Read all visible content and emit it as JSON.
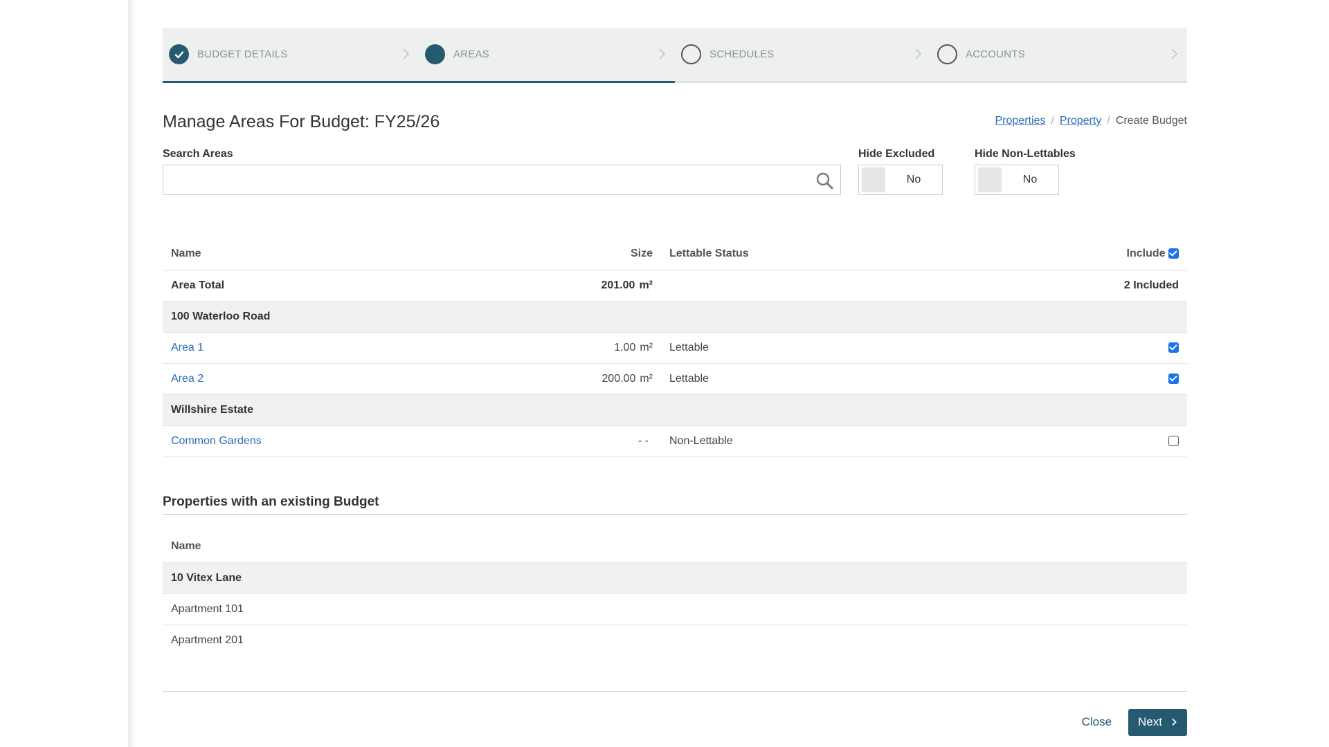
{
  "wizard": {
    "steps": [
      {
        "label": "BUDGET DETAILS",
        "state": "done"
      },
      {
        "label": "AREAS",
        "state": "current"
      },
      {
        "label": "SCHEDULES",
        "state": "todo"
      },
      {
        "label": "ACCOUNTS",
        "state": "todo"
      }
    ],
    "progress_fraction": 0.5,
    "accent_color": "#255a70"
  },
  "header": {
    "title": "Manage Areas For Budget: FY25/26",
    "breadcrumb": [
      {
        "label": "Properties",
        "link": true
      },
      {
        "label": "Property",
        "link": true
      },
      {
        "label": "Create Budget",
        "link": false
      }
    ],
    "separator": "/"
  },
  "filters": {
    "search_label": "Search Areas",
    "search_value": "",
    "hide_excluded_label": "Hide Excluded",
    "hide_excluded_value": "No",
    "hide_nonlettables_label": "Hide Non-Lettables",
    "hide_nonlettables_value": "No"
  },
  "areas_table": {
    "headers": {
      "name": "Name",
      "size": "Size",
      "status": "Lettable Status",
      "include": "Include"
    },
    "include_all_checked": true,
    "total": {
      "name": "Area Total",
      "size": "201.00",
      "unit": "m²",
      "included": "2 Included"
    },
    "groups": [
      {
        "name": "100 Waterloo Road",
        "rows": [
          {
            "name": "Area 1",
            "size": "1.00",
            "unit": "m²",
            "status": "Lettable",
            "included": true
          },
          {
            "name": "Area 2",
            "size": "200.00",
            "unit": "m²",
            "status": "Lettable",
            "included": true
          }
        ]
      },
      {
        "name": "Willshire Estate",
        "rows": [
          {
            "name": "Common Gardens",
            "size": "- -",
            "unit": "",
            "status": "Non-Lettable",
            "included": false
          }
        ]
      }
    ]
  },
  "existing_section": {
    "title": "Properties with an existing Budget",
    "header_name": "Name",
    "group": "10 Vitex Lane",
    "rows": [
      "Apartment 101",
      "Apartment 201"
    ]
  },
  "footer": {
    "close_label": "Close",
    "next_label": "Next"
  }
}
